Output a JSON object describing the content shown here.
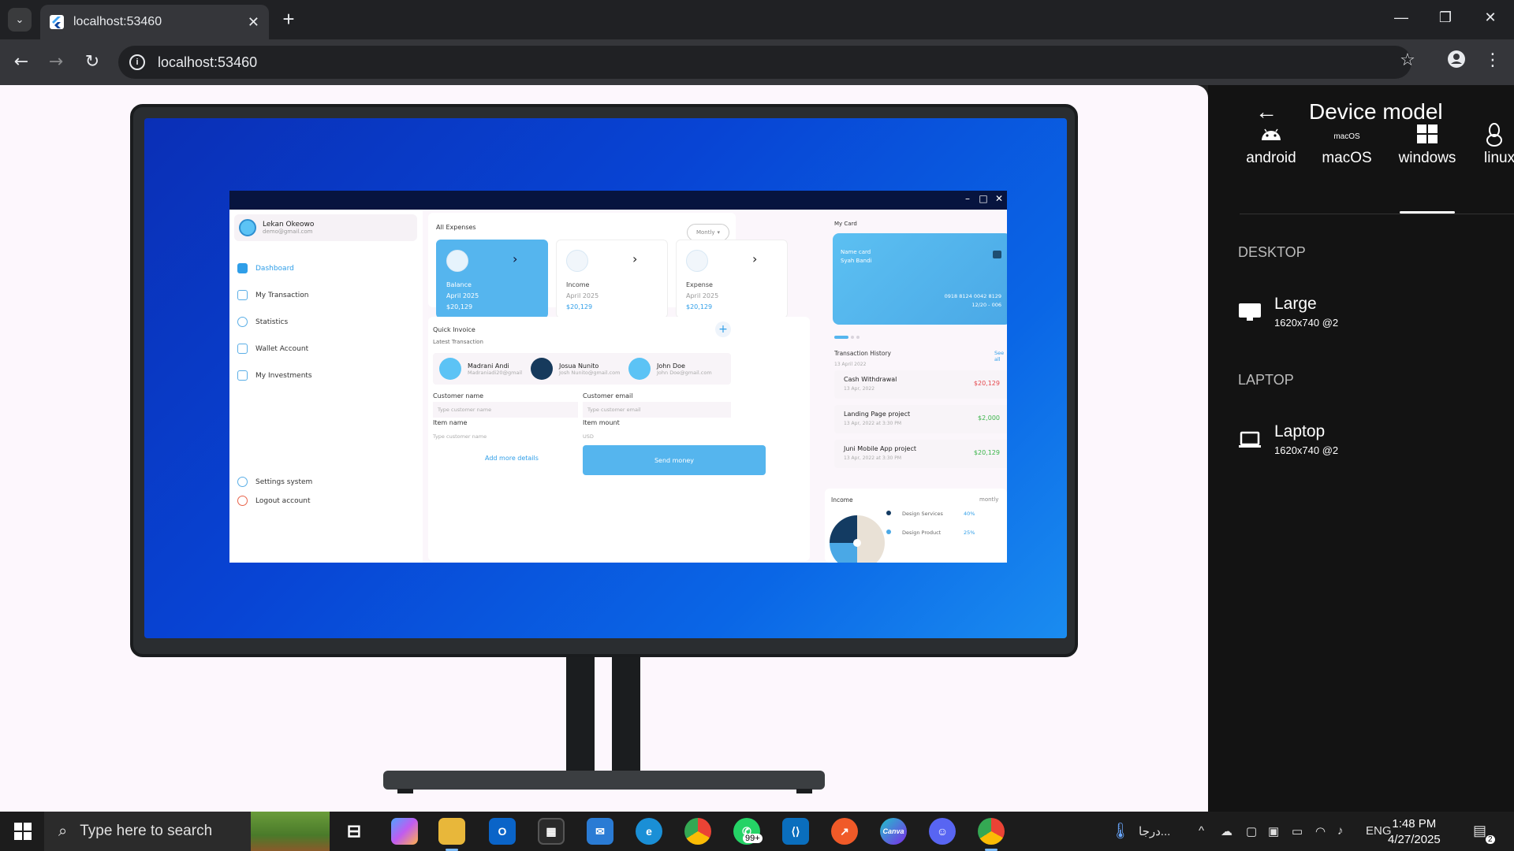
{
  "browser": {
    "tab_title": "localhost:53460",
    "tab_close": "✕",
    "new_tab": "+",
    "url": "localhost:53460",
    "window_controls": {
      "minimize": "—",
      "restore": "❐",
      "close": "✕"
    }
  },
  "app": {
    "user": {
      "name": "Lekan Okeowo",
      "email": "demo@gmail.com"
    },
    "nav": [
      {
        "label": "Dashboard",
        "active": true
      },
      {
        "label": "My Transaction",
        "active": false
      },
      {
        "label": "Statistics",
        "active": false
      },
      {
        "label": "Wallet Account",
        "active": false
      },
      {
        "label": "My Investments",
        "active": false
      }
    ],
    "nav_bottom": {
      "settings": "Settings system",
      "logout": "Logout account"
    },
    "expenses": {
      "title": "All Expenses",
      "filter": "Montly",
      "cards": [
        {
          "label": "Balance",
          "period": "April 2025",
          "amount": "$20,129"
        },
        {
          "label": "Income",
          "period": "April 2025",
          "amount": "$20,129"
        },
        {
          "label": "Expense",
          "period": "April 2025",
          "amount": "$20,129"
        }
      ]
    },
    "invoice": {
      "title": "Quick Invoice",
      "subtitle": "Latest Transaction",
      "add": "+",
      "contacts": [
        {
          "name": "Madrani Andi",
          "email": "Madraniadi20@gmail"
        },
        {
          "name": "Josua Nunito",
          "email": "Josh Nunito@gmail.com"
        },
        {
          "name": "John Doe",
          "email": "John Doe@gmail.com"
        }
      ],
      "customer_name_label": "Customer name",
      "customer_name_placeholder": "Type customer name",
      "customer_email_label": "Customer email",
      "customer_email_placeholder": "Type customer email",
      "item_name_label": "Item name",
      "item_name_placeholder": "Type customer name",
      "item_mount_label": "Item mount",
      "item_mount_placeholder": "USD",
      "add_more": "Add more details",
      "send": "Send money"
    },
    "card": {
      "title": "My Card",
      "name_label": "Name card",
      "holder": "Syah Bandi",
      "number": "0918 8124 0042 8129",
      "expiry": "12/20 - 006"
    },
    "history": {
      "title": "Transaction History",
      "see_all": "See all",
      "date": "13 April 2022",
      "items": [
        {
          "title": "Cash Withdrawal",
          "date": "13 Apr, 2022",
          "amount": "$20,129",
          "color": "#e5484d"
        },
        {
          "title": "Landing Page project",
          "date": "13 Apr, 2022 at 3:30 PM",
          "amount": "$2,000",
          "color": "#3bb54a"
        },
        {
          "title": "Juni Mobile App project",
          "date": "13 Apr, 2022 at 3:30 PM",
          "amount": "$20,129",
          "color": "#3bb54a"
        }
      ]
    },
    "income": {
      "title": "Income",
      "period": "montly",
      "legend": [
        {
          "label": "Design Services",
          "pct": "40%"
        },
        {
          "label": "Design Product",
          "pct": "25%"
        }
      ]
    }
  },
  "device_panel": {
    "title": "Device model",
    "os_tabs": [
      "android",
      "macOS",
      "windows",
      "linux"
    ],
    "os_selected": "windows",
    "macos_icon_text": "macOS",
    "sections": [
      {
        "heading": "DESKTOP",
        "device": "Large",
        "spec": "1620x740 @2"
      },
      {
        "heading": "LAPTOP",
        "device": "Laptop",
        "spec": "1620x740 @2"
      }
    ]
  },
  "taskbar": {
    "search_placeholder": "Type here to search",
    "weather_text": "درجا...",
    "language": "ENG",
    "time": "1:48 PM",
    "date": "4/27/2025",
    "whatsapp_badge": "99+",
    "notification_count": "2",
    "canva_label": "Canva"
  },
  "colors": {
    "accent": "#55b5ee",
    "window_bg": "#fdf7fd",
    "panel_bg": "#131313"
  }
}
